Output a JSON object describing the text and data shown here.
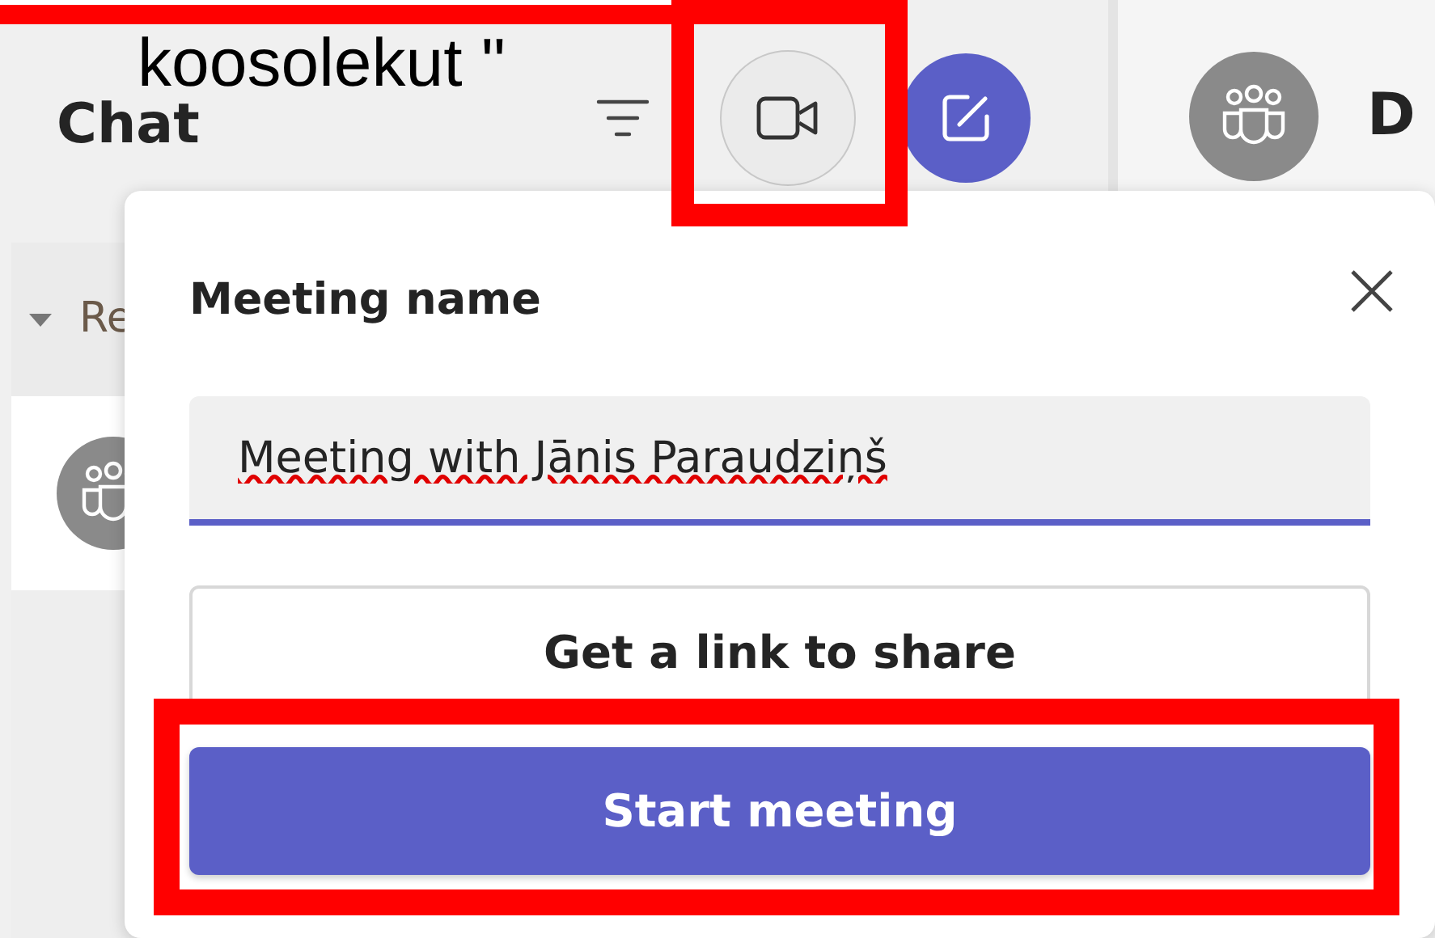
{
  "chat_panel": {
    "title": "Chat",
    "section_label": "Re"
  },
  "header_buttons": [
    {
      "kind": "filter"
    },
    {
      "kind": "meet",
      "highlighted": true
    },
    {
      "kind": "compose"
    }
  ],
  "conversation": {
    "title": "D"
  },
  "meeting_popup": {
    "title": "Meeting name",
    "name_field": {
      "value": "Meeting with Jānis Paraudziņš"
    },
    "buttons": [
      {
        "label": "Get a link to share",
        "kind": "secondary"
      },
      {
        "label": "Start meeting",
        "kind": "primary",
        "highlighted": true
      }
    ]
  },
  "annotation": {
    "text": "koosolekut \""
  }
}
